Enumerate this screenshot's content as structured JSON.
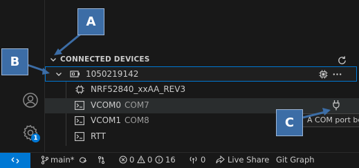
{
  "section": {
    "title": "CONNECTED DEVICES"
  },
  "device": {
    "serial": "1050219142",
    "children": [
      {
        "name": "NRF52840_xxAA_REV3",
        "detail": ""
      },
      {
        "name": "VCOM0",
        "detail": "COM7"
      },
      {
        "name": "VCOM1",
        "detail": "COM8"
      },
      {
        "name": "RTT",
        "detail": ""
      }
    ]
  },
  "tooltip": {
    "text": "A COM port be"
  },
  "activity": {
    "settings_badge": "1"
  },
  "status_bar": {
    "branch": "main*",
    "problems": {
      "errors": "0",
      "warnings": "0",
      "info": "16"
    },
    "ports": "0",
    "live_share": "Live Share",
    "git_graph": "Git Graph"
  },
  "callouts": {
    "a": "A",
    "b": "B",
    "c": "C"
  },
  "colors": {
    "accent": "#0078d4",
    "callout": "#3c6da6",
    "background": "#181818"
  },
  "icons": [
    "chevron-down-icon",
    "refresh-icon",
    "device-icon",
    "chip-icon",
    "terminal-icon",
    "more-icon",
    "plug-icon",
    "account-icon",
    "gear-icon",
    "remote-icon",
    "branch-icon",
    "sync-icon",
    "error-icon",
    "warning-icon",
    "info-icon",
    "broadcast-icon",
    "live-share-icon"
  ]
}
